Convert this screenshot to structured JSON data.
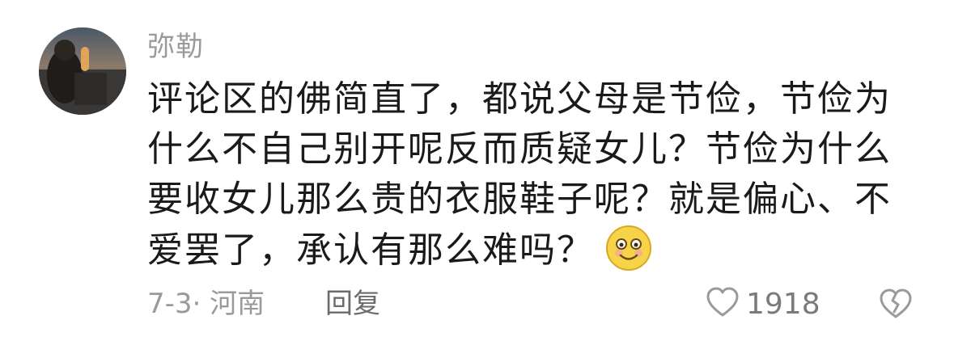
{
  "comment": {
    "username": "弥勒",
    "text": "评论区的佛简直了，都说父母是节俭，节俭为什么不自己别开呢反而质疑女儿？节俭为什么要收女儿那么贵的衣服鞋子呢？就是偏心、不爱罢了，承认有那么难吗？",
    "emoji": "smile-emoji",
    "meta": "7-3· 河南",
    "reply_label": "回复",
    "like_count": "1918"
  },
  "icons": {
    "like": "heart-outline-icon",
    "dislike": "broken-heart-outline-icon"
  },
  "colors": {
    "muted_text": "#9a9a9a",
    "body_text": "#1a1a1a",
    "emoji_yellow": "#f7d34a"
  }
}
